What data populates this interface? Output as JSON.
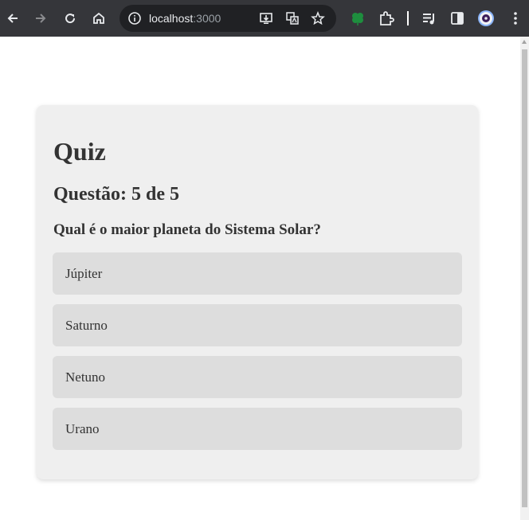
{
  "browser": {
    "url_host": "localhost",
    "url_port": ":3000",
    "icons": [
      "back-icon",
      "forward-icon",
      "reload-icon",
      "home-icon",
      "site-info-icon",
      "install-app-icon",
      "translate-icon",
      "bookmark-star-icon",
      "extension-clover-icon",
      "extensions-puzzle-icon",
      "media-controls-icon",
      "side-panel-icon",
      "profile-avatar-icon",
      "menu-dots-icon"
    ]
  },
  "quiz": {
    "title": "Quiz",
    "question_count": "Questão: 5 de 5",
    "question": "Qual é o maior planeta do Sistema Solar?",
    "answers": [
      "Júpiter",
      "Saturno",
      "Netuno",
      "Urano"
    ]
  },
  "colors": {
    "chrome_bg": "#35363a",
    "card_bg": "#efefef",
    "answer_bg": "#dddddd",
    "text": "#333333"
  }
}
